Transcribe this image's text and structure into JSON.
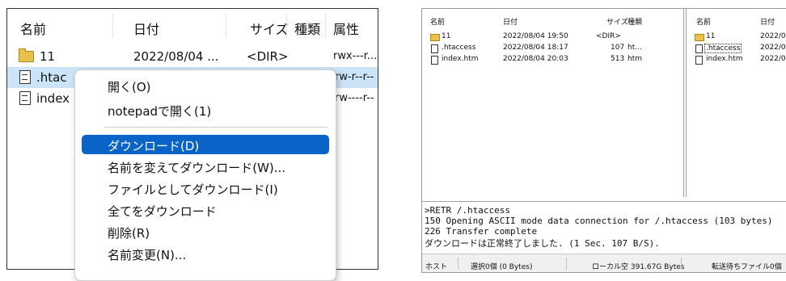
{
  "left_panel": {
    "columns": [
      "名前",
      "日付",
      "サイズ",
      "種類",
      "属性"
    ],
    "rows": [
      {
        "name": "11",
        "date": "2022/08/04 ...",
        "size": "<DIR>",
        "type": "",
        "attr": "rwx---r..."
      },
      {
        "name": ".htac",
        "date": "",
        "size": "",
        "type": "",
        "attr": "rw-r--r--"
      },
      {
        "name": "index",
        "date": "",
        "size": "",
        "type": "",
        "attr": "rw----r--"
      }
    ]
  },
  "context_menu": {
    "items": [
      "開く(O)",
      "notepadで開く(1)",
      "ダウンロード(D)",
      "名前を変えてダウンロード(W)...",
      "ファイルとしてダウンロード(I)",
      "全てをダウンロード",
      "削除(R)",
      "名前変更(N)..."
    ]
  },
  "ftp_app": {
    "local_pane": {
      "columns": [
        "名前",
        "日付",
        "サイズ",
        "種類"
      ],
      "rows": [
        {
          "name": "11",
          "date": "2022/08/04 19:50",
          "size": "<DIR>",
          "type": ""
        },
        {
          "name": ".htaccess",
          "date": "2022/08/04 18:17",
          "size": "107",
          "type": "ht..."
        },
        {
          "name": "index.htm",
          "date": "2022/08/04 20:03",
          "size": "513",
          "type": "htm"
        }
      ]
    },
    "remote_pane": {
      "columns": [
        "名前",
        "日付"
      ],
      "rows": [
        {
          "name": "11",
          "date": "2022/0"
        },
        {
          "name": ".htaccess",
          "date": "2022/0"
        },
        {
          "name": "index.htm",
          "date": "2022/0"
        }
      ]
    },
    "log": [
      ">RETR /.htaccess",
      "150 Opening ASCII mode data connection for /.htaccess (103 bytes)",
      "226 Transfer complete",
      "ダウンロードは正常終了しました. (1 Sec. 107 B/S)."
    ],
    "status": {
      "host": "ホスト",
      "selected": "選択0個 (0 Bytes)",
      "local_free": "ローカル空 391.67G Bytes",
      "queue": "転送待ちファイル0個"
    }
  }
}
